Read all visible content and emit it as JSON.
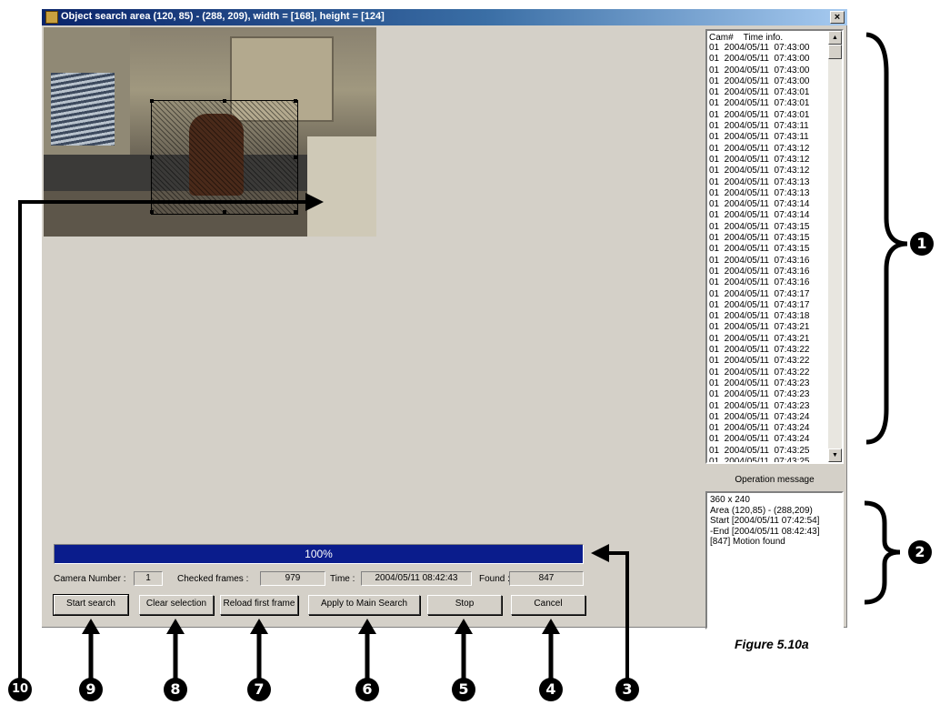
{
  "window": {
    "title": "Object search area (120, 85) - (288, 209), width = [168], height = [124]",
    "close_glyph": "×"
  },
  "list": {
    "header": "Cam#    Time info.",
    "rows": [
      "01  2004/05/11  07:43:00",
      "01  2004/05/11  07:43:00",
      "01  2004/05/11  07:43:00",
      "01  2004/05/11  07:43:00",
      "01  2004/05/11  07:43:01",
      "01  2004/05/11  07:43:01",
      "01  2004/05/11  07:43:01",
      "01  2004/05/11  07:43:11",
      "01  2004/05/11  07:43:11",
      "01  2004/05/11  07:43:12",
      "01  2004/05/11  07:43:12",
      "01  2004/05/11  07:43:12",
      "01  2004/05/11  07:43:13",
      "01  2004/05/11  07:43:13",
      "01  2004/05/11  07:43:14",
      "01  2004/05/11  07:43:14",
      "01  2004/05/11  07:43:15",
      "01  2004/05/11  07:43:15",
      "01  2004/05/11  07:43:15",
      "01  2004/05/11  07:43:16",
      "01  2004/05/11  07:43:16",
      "01  2004/05/11  07:43:16",
      "01  2004/05/11  07:43:17",
      "01  2004/05/11  07:43:17",
      "01  2004/05/11  07:43:18",
      "01  2004/05/11  07:43:21",
      "01  2004/05/11  07:43:21",
      "01  2004/05/11  07:43:22",
      "01  2004/05/11  07:43:22",
      "01  2004/05/11  07:43:22",
      "01  2004/05/11  07:43:23",
      "01  2004/05/11  07:43:23",
      "01  2004/05/11  07:43:23",
      "01  2004/05/11  07:43:24",
      "01  2004/05/11  07:43:24",
      "01  2004/05/11  07:43:24",
      "01  2004/05/11  07:43:25",
      "01  2004/05/11  07:43:25"
    ]
  },
  "operation": {
    "label": "Operation message",
    "lines": [
      "360 x 240",
      "Area (120,85) - (288,209)",
      "Start [2004/05/11 07:42:54]",
      "-End [2004/05/11 08:42:43]",
      "[847] Motion found"
    ]
  },
  "progress": {
    "label": "100%",
    "value": 1.0
  },
  "info": {
    "camera_label": "Camera Number :",
    "camera_value": "1",
    "checked_label": "Checked frames :",
    "checked_value": "979",
    "time_label": "Time :",
    "time_value": "2004/05/11  08:42:43",
    "found_label": "Found :",
    "found_value": "847"
  },
  "buttons": {
    "start": "Start search",
    "clear": "Clear selection",
    "reload": "Reload first frame",
    "apply": "Apply to Main Search",
    "stop": "Stop",
    "cancel": "Cancel"
  },
  "callouts": {
    "c1": "1",
    "c2": "2",
    "c3": "3",
    "c4": "4",
    "c5": "5",
    "c6": "6",
    "c7": "7",
    "c8": "8",
    "c9": "9",
    "c10": "10"
  },
  "caption": "Figure 5.10a",
  "colors": {
    "title_bar": "#0a246a",
    "progress_fill": "#0a1c8c",
    "window_bg": "#d4d0c8"
  }
}
